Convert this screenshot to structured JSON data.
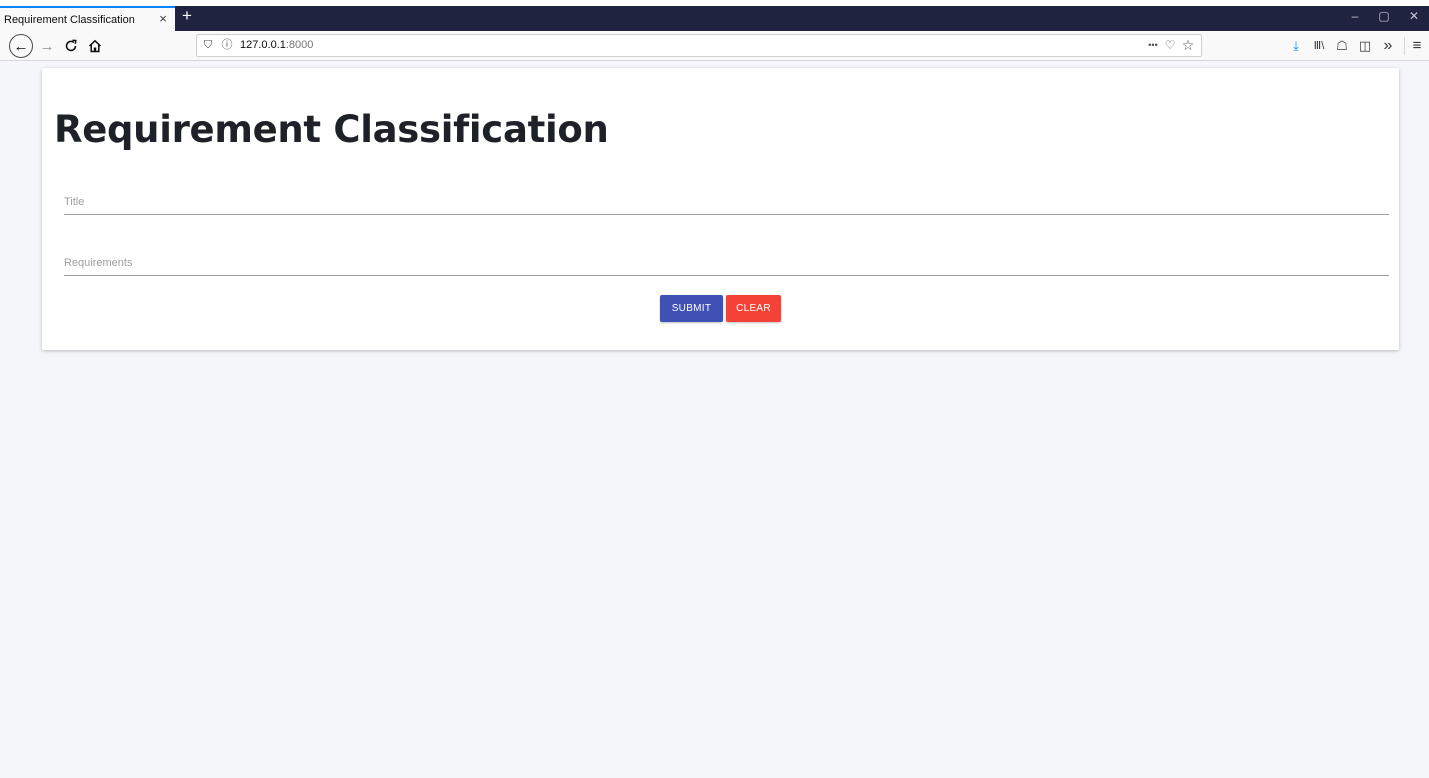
{
  "browser": {
    "tab": {
      "title": "Requirement Classification",
      "close_icon": "×"
    },
    "new_tab_icon": "+",
    "window_controls": {
      "minimize": "–",
      "restore": "▢",
      "close": "✕"
    },
    "nav": {
      "back": "←",
      "forward": "→",
      "reload": "C",
      "home": "⌂"
    },
    "url": {
      "shield": "⛉",
      "info": "ⓘ",
      "host": "127.0.0.1",
      "port": ":8000"
    },
    "url_actions": {
      "more": "•••",
      "pocket": "♡",
      "bookmark": "☆"
    },
    "toolbar": {
      "download": "⤓",
      "library": "Ⅲ\\",
      "extension": "☖",
      "sidebar": "◫",
      "overflow": "»",
      "menu": "≡"
    },
    "accent_color": "#0a84ff"
  },
  "page": {
    "title": "Requirement Classification",
    "form": {
      "title_placeholder": "Title",
      "title_value": "",
      "requirements_placeholder": "Requirements",
      "requirements_value": "",
      "submit_label": "SUBMIT",
      "clear_label": "CLEAR"
    },
    "colors": {
      "submit": "#3f51b5",
      "clear": "#f44336",
      "background": "#f4f6fa"
    }
  }
}
